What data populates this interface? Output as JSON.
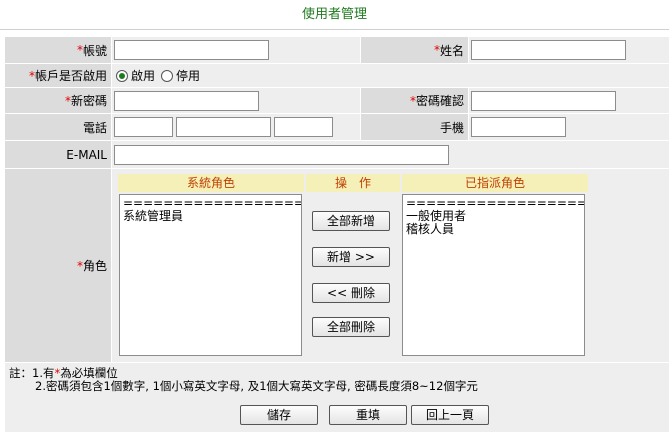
{
  "header": {
    "title": "使用者管理"
  },
  "form": {
    "account": {
      "label": "帳號",
      "required": "*",
      "value": ""
    },
    "name": {
      "label": "姓名",
      "required": "*",
      "value": ""
    },
    "enabled": {
      "label": "帳戶是否啟用",
      "required": "*",
      "options": [
        "啟用",
        "停用"
      ],
      "selected": "啟用"
    },
    "new_password": {
      "label": "新密碼",
      "required": "*",
      "value": ""
    },
    "confirm_password": {
      "label": "密碼確認",
      "required": "*",
      "value": ""
    },
    "phone": {
      "label": "電話",
      "part1": "",
      "part2": "",
      "part3": ""
    },
    "mobile": {
      "label": "手機",
      "value": ""
    },
    "email": {
      "label": "E-MAIL",
      "value": ""
    },
    "role": {
      "label": "角色",
      "required": "*"
    }
  },
  "roles": {
    "system_header": "系統角色",
    "op_header": "操　作",
    "assigned_header": "已指派角色",
    "system_items": [
      "====================",
      "系統管理員"
    ],
    "assigned_items": [
      "====================",
      "一般使用者",
      "稽核人員"
    ],
    "buttons": {
      "add_all": "全部新增",
      "add": "新增 >>",
      "remove": "<< 刪除",
      "remove_all": "全部刪除"
    }
  },
  "notes": {
    "prefix": "註：1.有",
    "star": "*",
    "suffix": "為必填欄位",
    "line2": "2.密碼須包含1個數字, 1個小寫英文字母, 及1個大寫英文字母, 密碼長度須8~12個字元"
  },
  "actions": {
    "save": "儲存",
    "reset": "重填",
    "back": "回上一頁"
  }
}
